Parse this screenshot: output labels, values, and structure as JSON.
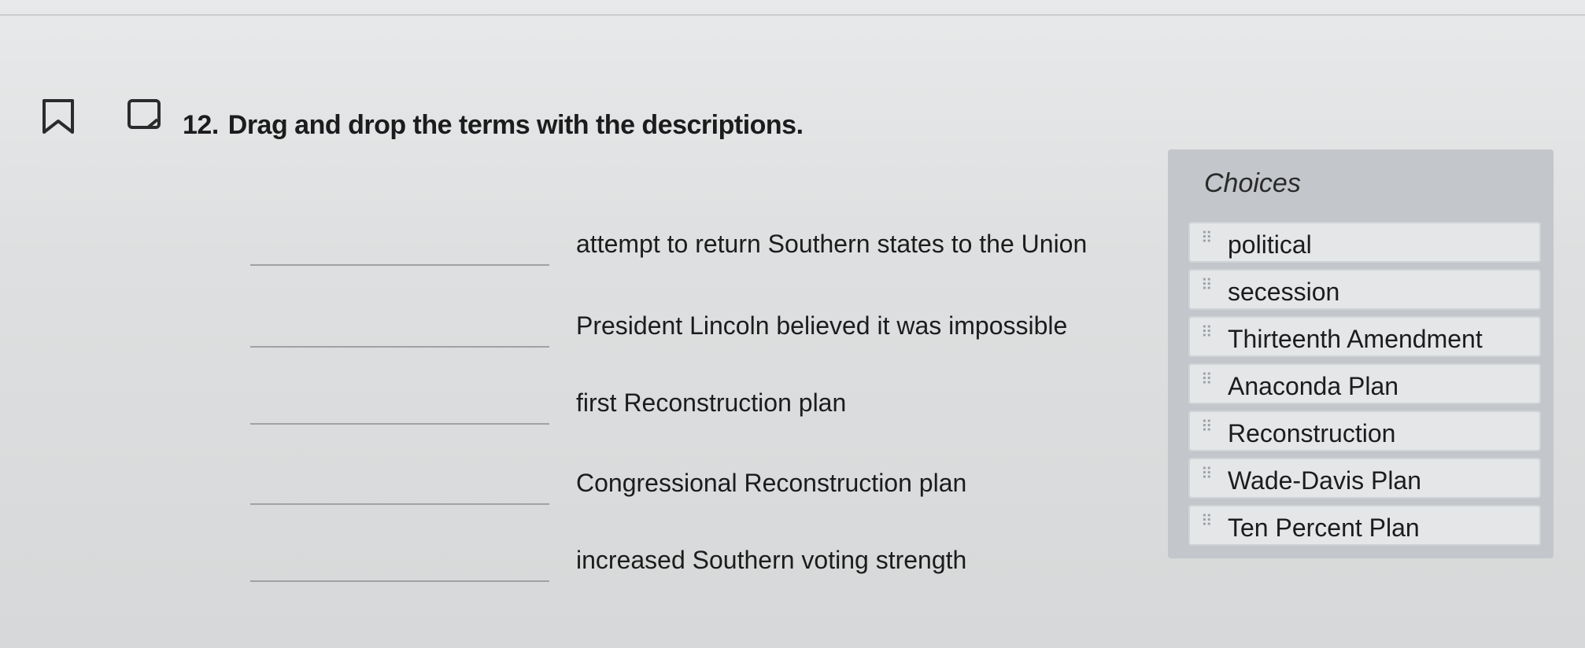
{
  "question": {
    "number": "12.",
    "prompt": "Drag and drop the terms with the descriptions."
  },
  "descriptions": [
    "attempt to return Southern states to the Union",
    "President Lincoln believed it was impossible",
    "first Reconstruction plan",
    "Congressional Reconstruction plan",
    "increased Southern voting strength"
  ],
  "choices": {
    "title": "Choices",
    "items": [
      "political",
      "secession",
      "Thirteenth Amendment",
      "Anaconda Plan",
      "Reconstruction",
      "Wade-Davis Plan",
      "Ten Percent Plan"
    ]
  },
  "icons": {
    "bookmark": "bookmark-icon",
    "flag": "flag-icon",
    "drag_handle": "drag-handle-icon"
  }
}
